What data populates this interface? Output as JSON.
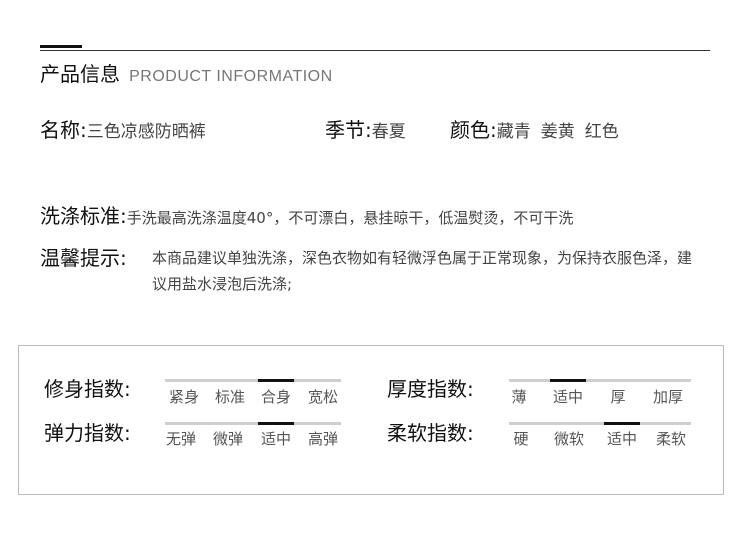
{
  "header": {
    "title_cn": "产品信息",
    "title_en": "PRODUCT INFORMATION"
  },
  "name": {
    "label": "名称:",
    "value": "三色凉感防晒裤"
  },
  "season": {
    "label": "季节:",
    "value": "春夏"
  },
  "color": {
    "label": "颜色:",
    "options": [
      "藏青",
      "姜黄",
      "红色"
    ]
  },
  "washing": {
    "label": "洗涤标准:",
    "text": "手洗最高洗涤温度40°，不可漂白，悬挂晾干，低温熨烫，不可干洗"
  },
  "tips": {
    "label": "温馨提示:",
    "text": "本商品建议单独洗涤，深色衣物如有轻微浮色属于正常现象，为保持衣服色泽，建议用盐水浸泡后洗涤;"
  },
  "indices": {
    "fit": {
      "label": "修身指数:",
      "options": [
        "紧身",
        "标准",
        "合身",
        "宽松"
      ],
      "selected": "合身"
    },
    "elastic": {
      "label": "弹力指数:",
      "options": [
        "无弹",
        "微弹",
        "适中",
        "高弹"
      ],
      "selected": "适中"
    },
    "thickness": {
      "label": "厚度指数:",
      "options": [
        "薄",
        "适中",
        "厚",
        "加厚"
      ],
      "selected": "适中"
    },
    "softness": {
      "label": "柔软指数:",
      "options": [
        "硬",
        "微软",
        "适中",
        "柔软"
      ],
      "selected": "适中"
    }
  }
}
